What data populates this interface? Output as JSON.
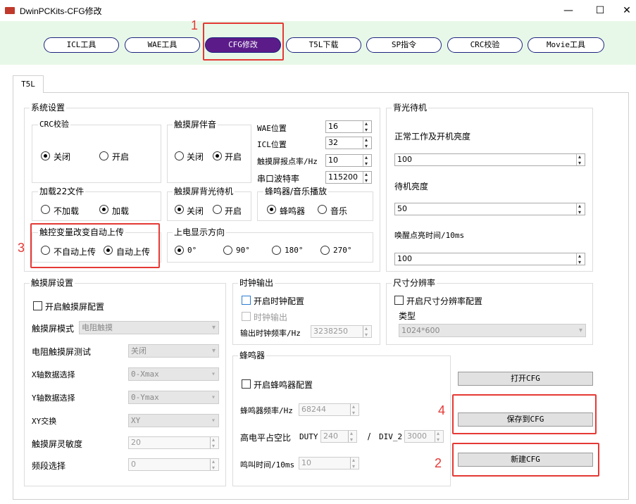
{
  "window": {
    "title": "DwinPCKits-CFG修改",
    "min": "—",
    "max": "☐",
    "close": "✕"
  },
  "nav": {
    "tabs": [
      "ICL工具",
      "WAE工具",
      "CFG修改",
      "T5L下载",
      "SP指令",
      "CRC校验",
      "Movie工具"
    ],
    "active": 2
  },
  "annotations": {
    "n1": "1",
    "n2": "2",
    "n3": "3",
    "n4": "4"
  },
  "tab": {
    "label": "T5L"
  },
  "sys": {
    "title": "系统设置",
    "crc": {
      "title": "CRC校验",
      "off": "关闭",
      "on": "开启",
      "selected": "off"
    },
    "buzz": {
      "title": "触摸屏伴音",
      "off": "关闭",
      "on": "开启",
      "selected": "on"
    },
    "wae_label": "WAE位置",
    "wae_value": "16",
    "icl_label": "ICL位置",
    "icl_value": "32",
    "rate_label": "触摸屏报点率/Hz",
    "rate_value": "10",
    "baud_label": "串口波特率",
    "baud_value": "115200",
    "load22": {
      "title": "加载22文件",
      "no": "不加载",
      "yes": "加载",
      "selected": "yes"
    },
    "backlight": {
      "title": "触摸屏背光待机",
      "off": "关闭",
      "on": "开启",
      "selected": "off"
    },
    "sound": {
      "title": "蜂鸣器/音乐播放",
      "buzzer": "蜂鸣器",
      "music": "音乐",
      "selected": "buzzer"
    },
    "autoup": {
      "title": "触控变量改变自动上传",
      "no": "不自动上传",
      "yes": "自动上传",
      "selected": "yes"
    },
    "rotate": {
      "title": "上电显示方向",
      "o0": "0°",
      "o90": "90°",
      "o180": "180°",
      "o270": "270°",
      "selected": "0"
    }
  },
  "bl": {
    "title": "背光待机",
    "normal_label": "正常工作及开机亮度",
    "normal_value": "100",
    "standby_label": "待机亮度",
    "standby_value": "50",
    "wake_label": "唤醒点亮时间/10ms",
    "wake_value": "100"
  },
  "touch": {
    "title": "触摸屏设置",
    "enable": "开启触摸屏配置",
    "mode_label": "触摸屏模式",
    "mode_value": "电阻触摸",
    "test_label": "电阻触摸屏测试",
    "test_value": "关闭",
    "x_label": "X轴数据选择",
    "x_value": "0-Xmax",
    "y_label": "Y轴数据选择",
    "y_value": "0-Ymax",
    "xy_label": "XY交换",
    "xy_value": "XY",
    "sens_label": "触摸屏灵敏度",
    "sens_value": "20",
    "band_label": "频段选择",
    "band_value": "0"
  },
  "clock": {
    "title": "时钟输出",
    "enable": "开启时钟配置",
    "out": "时钟输出",
    "freq_label": "输出时钟频率/Hz",
    "freq_value": "3238250"
  },
  "size": {
    "title": "尺寸分辨率",
    "enable": "开启尺寸分辨率配置",
    "type_label": "类型",
    "type_value": "1024*600"
  },
  "beep": {
    "title": "蜂鸣器",
    "enable": "开启蜂鸣器配置",
    "freq_label": "蜂鸣器频率/Hz",
    "freq_value": "68244",
    "duty_label": "高电平占空比",
    "duty": "DUTY",
    "duty_value": "240",
    "slash": "/",
    "div": "DIV_2",
    "div_value": "3000",
    "time_label": "鸣叫时间/10ms",
    "time_value": "10"
  },
  "actions": {
    "open": "打开CFG",
    "save": "保存到CFG",
    "new": "新建CFG"
  },
  "colors": {
    "accent": "#5b1c8a",
    "annotation": "#e53935",
    "band": "#e8f8e8"
  }
}
